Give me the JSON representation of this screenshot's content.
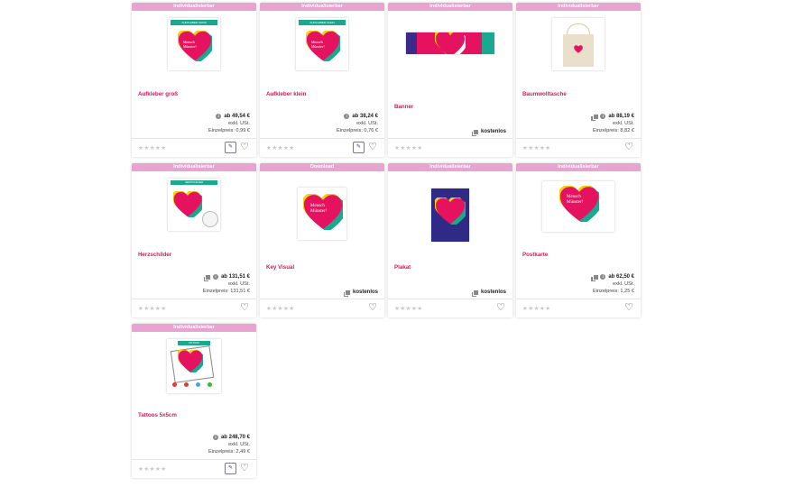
{
  "colors": {
    "accent": "#d6185e",
    "tag_bg": "#e8a3d0"
  },
  "products": [
    {
      "tag": "Individualisierbar",
      "name": "Aufkleber groß",
      "price": "ab 49,54 €",
      "tax": "exkl. USt.",
      "unit": "Einzelpreis: 0,99 €",
      "editable": true,
      "thumb_label": "AUFKLEBER GROß"
    },
    {
      "tag": "Individualisierbar",
      "name": "Aufkleber klein",
      "price": "ab 38,24 €",
      "tax": "exkl. USt.",
      "unit": "Einzelpreis: 0,76 €",
      "editable": true,
      "thumb_label": "AUFKLEBER KLEIN"
    },
    {
      "tag": "Individualisierbar",
      "name": "Banner",
      "price": "kostenlos",
      "editable": false
    },
    {
      "tag": "Individualisierbar",
      "name": "Baumwolltasche",
      "price": "ab 88,19 €",
      "tax": "exkl. USt.",
      "unit": "Einzelpreis: 8,82 €",
      "editable": false
    },
    {
      "tag": "Individualisierbar",
      "name": "Herzschilder",
      "price": "ab 131,51 €",
      "tax": "exkl. USt.",
      "unit": "Einzelpreis: 131,51 €",
      "editable": false,
      "thumb_label": "HERZSCHILDER"
    },
    {
      "tag": "Download",
      "name": "Key Visual",
      "price": "kostenlos",
      "editable": false
    },
    {
      "tag": "Individualisierbar",
      "name": "Plakat",
      "price": "kostenlos",
      "editable": false
    },
    {
      "tag": "Individualisierbar",
      "name": "Postkarte",
      "price": "ab 62,50 €",
      "tax": "exkl. USt.",
      "unit": "Einzelpreis: 1,25 €",
      "editable": false
    },
    {
      "tag": "Individualisierbar",
      "name": "Tattoos 5x5cm",
      "price": "ab 248,70 €",
      "tax": "exkl. USt.",
      "unit": "Einzelpreis: 2,49 €",
      "editable": true,
      "thumb_label": "TATTOOS"
    }
  ],
  "heart_text": {
    "line1": "Mensch",
    "line2": "Münster!"
  },
  "rating_stars": "★★★★★"
}
